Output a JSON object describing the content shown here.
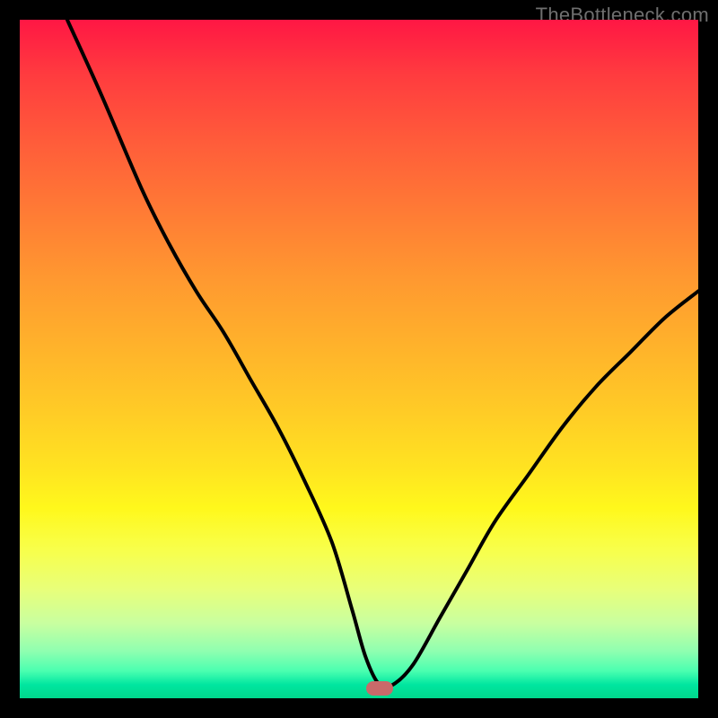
{
  "watermark": "TheBottleneck.com",
  "colors": {
    "frame": "#000000",
    "curve": "#000000",
    "marker": "#c96a6a",
    "gradient_top": "#ff1744",
    "gradient_bottom": "#00d88c"
  },
  "chart_data": {
    "type": "line",
    "title": "",
    "xlabel": "",
    "ylabel": "",
    "xlim": [
      0,
      100
    ],
    "ylim": [
      0,
      100
    ],
    "grid": false,
    "legend": false,
    "marker": {
      "x": 53,
      "y": 1.5,
      "shape": "pill"
    },
    "series": [
      {
        "name": "bottleneck-curve",
        "x": [
          7,
          12,
          18,
          22,
          26,
          30,
          34,
          38,
          42,
          46,
          49,
          51,
          53,
          55,
          58,
          62,
          66,
          70,
          75,
          80,
          85,
          90,
          95,
          100
        ],
        "y": [
          100,
          89,
          75,
          67,
          60,
          54,
          47,
          40,
          32,
          23,
          13,
          6,
          2,
          2,
          5,
          12,
          19,
          26,
          33,
          40,
          46,
          51,
          56,
          60
        ]
      }
    ]
  }
}
